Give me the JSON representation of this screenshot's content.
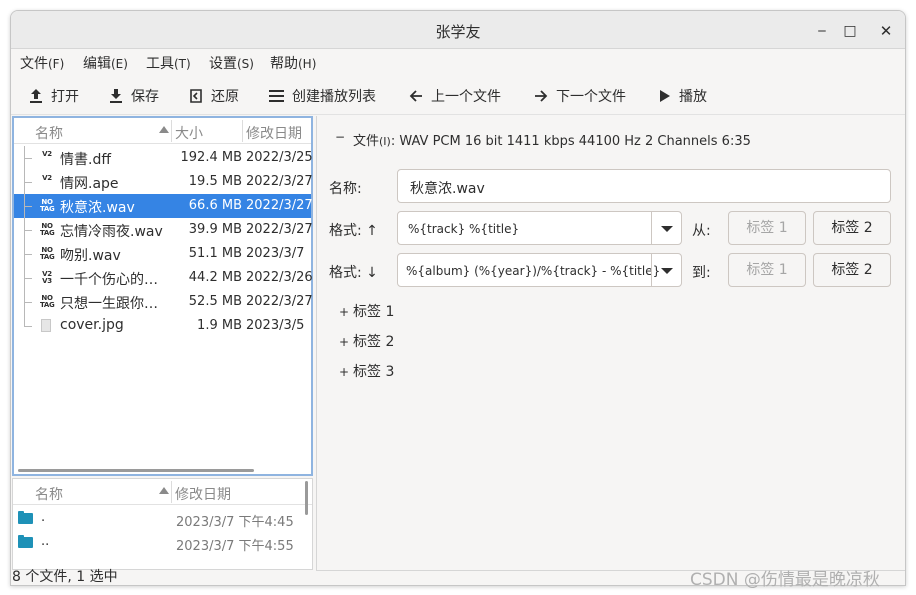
{
  "window": {
    "title": "张学友",
    "close_glyph": "✕",
    "minimize_glyph": "‒",
    "maximize_glyph": "□"
  },
  "menu": [
    {
      "label": "文件",
      "accel": "(F)"
    },
    {
      "label": "编辑",
      "accel": "(E)"
    },
    {
      "label": "工具",
      "accel": "(T)"
    },
    {
      "label": "设置",
      "accel": "(S)"
    },
    {
      "label": "帮助",
      "accel": "(H)"
    }
  ],
  "toolbar": {
    "open": "打开",
    "save": "保存",
    "revert": "还原",
    "create_playlist": "创建播放列表",
    "prev_file": "上一个文件",
    "next_file": "下一个文件",
    "play": "播放"
  },
  "file_list": {
    "headers": {
      "name": "名称",
      "size": "大小",
      "date": "修改日期"
    },
    "rows": [
      {
        "tag": "V2",
        "name": "情書.dff",
        "size": "192.4 MB",
        "date": "2022/3/25"
      },
      {
        "tag": "V2",
        "name": "情网.ape",
        "size": "19.5 MB",
        "date": "2022/3/27"
      },
      {
        "tag": "NO TAG",
        "name": "秋意浓.wav",
        "size": "66.6 MB",
        "date": "2022/3/27",
        "selected": true
      },
      {
        "tag": "NO TAG",
        "name": "忘情冷雨夜.wav",
        "size": "39.9 MB",
        "date": "2022/3/27"
      },
      {
        "tag": "NO TAG",
        "name": "吻别.wav",
        "size": "51.1 MB",
        "date": "2023/3/7"
      },
      {
        "tag": "V2 V3",
        "name": "一千个伤心的…",
        "size": "44.2 MB",
        "date": "2022/3/26"
      },
      {
        "tag": "NO TAG",
        "name": "只想一生跟你…",
        "size": "52.5 MB",
        "date": "2022/3/27"
      },
      {
        "tag": "img",
        "name": "cover.jpg",
        "size": "1.9 MB",
        "date": "2023/3/5"
      }
    ]
  },
  "dir_list": {
    "headers": {
      "name": "名称",
      "date": "修改日期"
    },
    "rows": [
      {
        "name": ".",
        "date": "2023/3/7  下午4:45"
      },
      {
        "name": "..",
        "date": "2023/3/7  下午4:55"
      }
    ]
  },
  "details": {
    "file_label": "文件",
    "file_accel": "(I)",
    "file_info": ": WAV PCM 16 bit 1411 kbps 44100 Hz 2 Channels 6:35",
    "name_label": "名称:",
    "name_value": "秋意浓.wav",
    "format_up_label": "格式: ↑",
    "format_up_value": "%{track} %{title}",
    "from_label": "从:",
    "format_down_label": "格式: ↓",
    "format_down_value": "%{album} (%{year})/%{track} - %{title}",
    "to_label": "到:",
    "tag1_btn": "标签 1",
    "tag2_btn": "标签 2",
    "tag_sections": [
      "标签 1",
      "标签 2",
      "标签 3"
    ]
  },
  "status": {
    "text": "8 个文件, 1 选中"
  },
  "watermark": "CSDN @伤情最是晚凉秋",
  "colors": {
    "selection": "#3584e4",
    "folder": "#1e91b7",
    "focus_border": "#8fb4e0"
  }
}
